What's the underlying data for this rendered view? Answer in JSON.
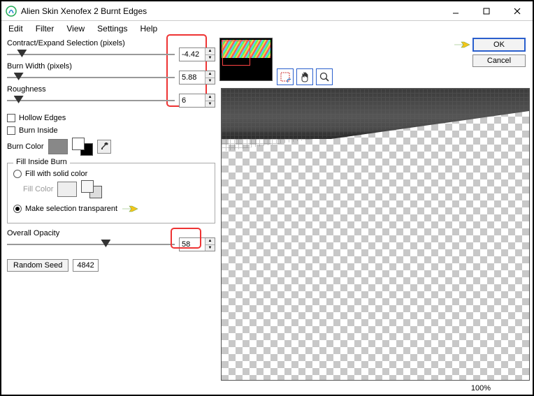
{
  "window": {
    "title": "Alien Skin Xenofex 2 Burnt Edges"
  },
  "menu": {
    "items": [
      "Edit",
      "Filter",
      "View",
      "Settings",
      "Help"
    ]
  },
  "params": {
    "contract": {
      "label": "Contract/Expand Selection (pixels)",
      "value": "-4.42",
      "thumb_pct": 6
    },
    "burnwidth": {
      "label": "Burn Width (pixels)",
      "value": "5.88",
      "thumb_pct": 4
    },
    "roughness": {
      "label": "Roughness",
      "value": "6",
      "thumb_pct": 4
    },
    "opacity": {
      "label": "Overall Opacity",
      "value": "58",
      "thumb_pct": 56
    }
  },
  "checks": {
    "hollow": "Hollow Edges",
    "burninside": "Burn Inside"
  },
  "burncolor_label": "Burn Color",
  "fillinside": {
    "legend": "Fill Inside Burn",
    "solid": "Fill with solid color",
    "fillcolor": "Fill Color",
    "transparent": "Make selection transparent"
  },
  "seed": {
    "btn": "Random Seed",
    "value": "4842"
  },
  "buttons": {
    "ok": "OK",
    "cancel": "Cancel"
  },
  "status": {
    "zoom": "100%"
  }
}
